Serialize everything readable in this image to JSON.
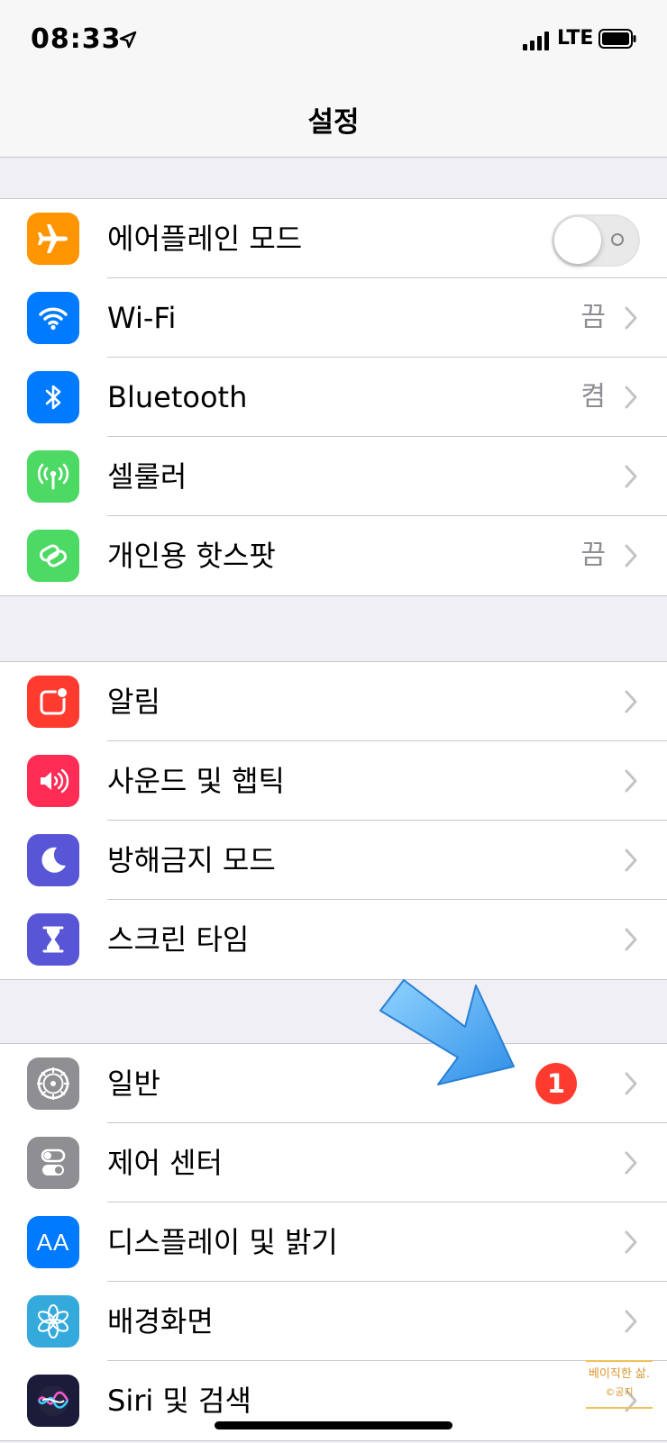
{
  "status_bar": {
    "time": "08:33",
    "network": "LTE",
    "icons": [
      "location-arrow-icon",
      "signal-icon",
      "battery-icon"
    ]
  },
  "nav": {
    "title": "설정"
  },
  "groups": [
    {
      "items": [
        {
          "label": "에어플레인 모드",
          "icon": "airplane-icon",
          "color": "#ff9500",
          "control": "toggle",
          "toggle_on": false
        },
        {
          "label": "Wi-Fi",
          "icon": "wifi-icon",
          "color": "#007aff",
          "value": "끔"
        },
        {
          "label": "Bluetooth",
          "icon": "bluetooth-icon",
          "color": "#007aff",
          "value": "켬"
        },
        {
          "label": "셀룰러",
          "icon": "antenna-icon",
          "color": "#4cd964"
        },
        {
          "label": "개인용 핫스팟",
          "icon": "hotspot-link-icon",
          "color": "#4cd964",
          "value": "끔"
        }
      ]
    },
    {
      "items": [
        {
          "label": "알림",
          "icon": "notifications-icon",
          "color": "#ff3b30"
        },
        {
          "label": "사운드 및 햅틱",
          "icon": "speaker-icon",
          "color": "#ff2d55"
        },
        {
          "label": "방해금지 모드",
          "icon": "moon-icon",
          "color": "#5856d6"
        },
        {
          "label": "스크린 타임",
          "icon": "hourglass-icon",
          "color": "#5856d6"
        }
      ]
    },
    {
      "items": [
        {
          "label": "일반",
          "icon": "gear-icon",
          "color": "#8e8e93",
          "badge": "1"
        },
        {
          "label": "제어 센터",
          "icon": "control-center-icon",
          "color": "#8e8e93"
        },
        {
          "label": "디스플레이 및 밝기",
          "icon": "text-size-icon",
          "color": "#007aff",
          "icon_text": "AA"
        },
        {
          "label": "배경화면",
          "icon": "flower-icon",
          "color": "#34aadc"
        },
        {
          "label": "Siri 및 검색",
          "icon": "siri-icon",
          "color": "#1b1b3a"
        }
      ]
    }
  ],
  "annotation": {
    "arrow_color": "#4aa8f0"
  },
  "watermark": {
    "line1": "베이직한 삶.",
    "line2": "©공지"
  }
}
